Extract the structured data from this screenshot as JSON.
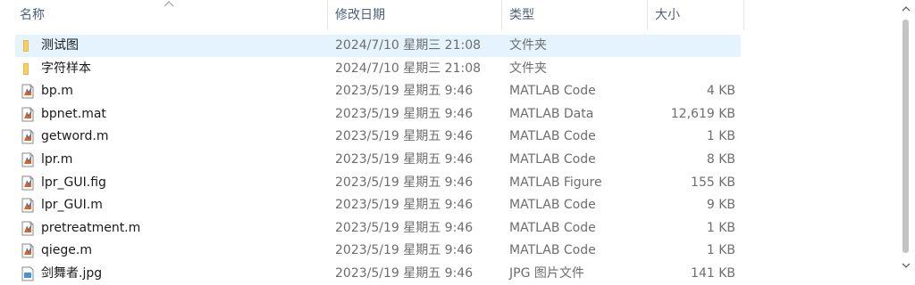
{
  "columns": {
    "name": "名称",
    "modified": "修改日期",
    "type": "类型",
    "size": "大小"
  },
  "files": [
    {
      "name": "测试图",
      "date": "2024/7/10 星期三 21:08",
      "type": "文件夹",
      "size": "",
      "icon": "folder-icon",
      "selected": true
    },
    {
      "name": "字符样本",
      "date": "2024/7/10 星期三 21:08",
      "type": "文件夹",
      "size": "",
      "icon": "folder-icon",
      "selected": false
    },
    {
      "name": "bp.m",
      "date": "2023/5/19 星期五 9:46",
      "type": "MATLAB Code",
      "size": "4 KB",
      "icon": "matlab-file-icon",
      "selected": false
    },
    {
      "name": "bpnet.mat",
      "date": "2023/5/19 星期五 9:46",
      "type": "MATLAB Data",
      "size": "12,619 KB",
      "icon": "matlab-file-icon",
      "selected": false
    },
    {
      "name": "getword.m",
      "date": "2023/5/19 星期五 9:46",
      "type": "MATLAB Code",
      "size": "1 KB",
      "icon": "matlab-file-icon",
      "selected": false
    },
    {
      "name": "lpr.m",
      "date": "2023/5/19 星期五 9:46",
      "type": "MATLAB Code",
      "size": "8 KB",
      "icon": "matlab-file-icon",
      "selected": false
    },
    {
      "name": "lpr_GUI.fig",
      "date": "2023/5/19 星期五 9:46",
      "type": "MATLAB Figure",
      "size": "155 KB",
      "icon": "matlab-file-icon",
      "selected": false
    },
    {
      "name": "lpr_GUI.m",
      "date": "2023/5/19 星期五 9:46",
      "type": "MATLAB Code",
      "size": "9 KB",
      "icon": "matlab-file-icon",
      "selected": false
    },
    {
      "name": "pretreatment.m",
      "date": "2023/5/19 星期五 9:46",
      "type": "MATLAB Code",
      "size": "1 KB",
      "icon": "matlab-file-icon",
      "selected": false
    },
    {
      "name": "qiege.m",
      "date": "2023/5/19 星期五 9:46",
      "type": "MATLAB Code",
      "size": "1 KB",
      "icon": "matlab-file-icon",
      "selected": false
    },
    {
      "name": "剑舞者.jpg",
      "date": "2023/5/19 星期五 9:46",
      "type": "JPG 图片文件",
      "size": "141 KB",
      "icon": "image-file-icon",
      "selected": false
    }
  ],
  "colors": {
    "selected_row": "#e5f3ff",
    "header_text": "#4c607a",
    "folder": "#e8b84a"
  }
}
